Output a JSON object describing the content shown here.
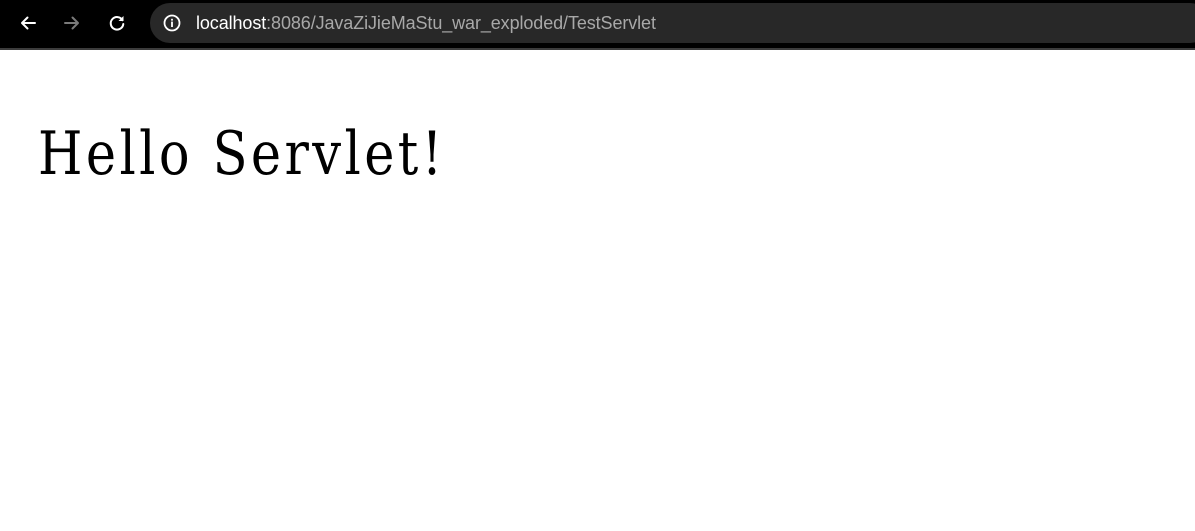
{
  "browser": {
    "url_host": "localhost",
    "url_rest": ":8086/JavaZiJieMaStu_war_exploded/TestServlet",
    "icons": {
      "back": "arrow-left-icon",
      "forward": "arrow-right-icon",
      "reload": "reload-icon",
      "site_info": "info-icon"
    },
    "colors": {
      "toolbar_bg": "#000000",
      "omnibox_bg": "#282828",
      "host_text": "#ffffff",
      "path_text": "#a8a8a8",
      "forward_disabled": "#7a7a7a"
    }
  },
  "page": {
    "heading": "Hello Servlet!"
  }
}
